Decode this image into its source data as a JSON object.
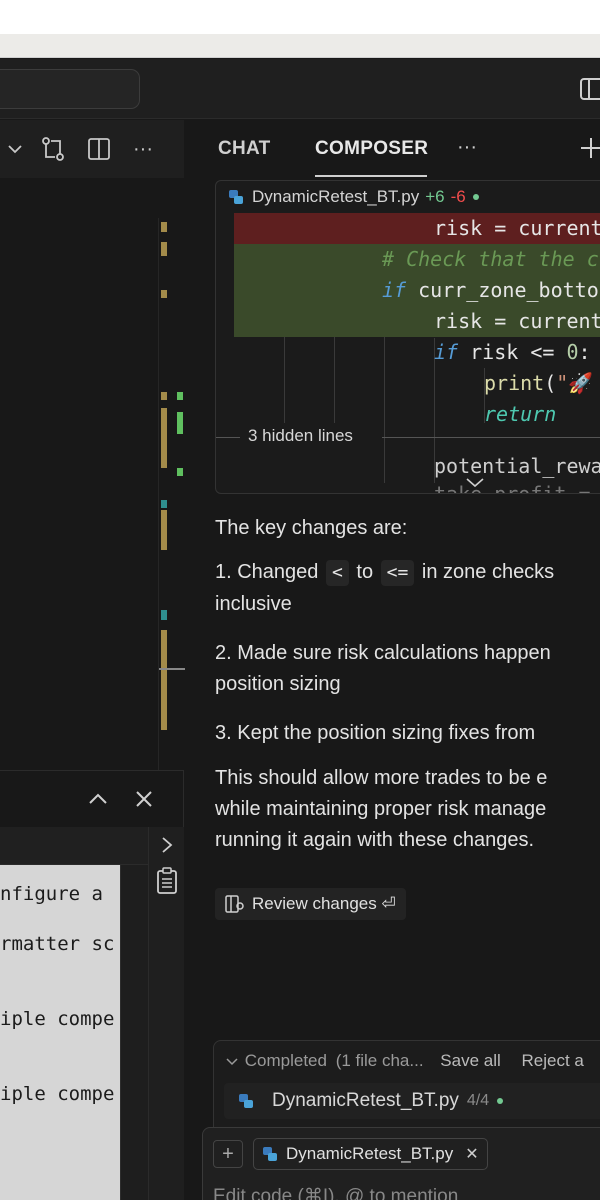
{
  "titlebar": {
    "search_icon": "search-box",
    "layout_icon": "toggle-layout-icon"
  },
  "editor_toolbar": {
    "icons": [
      "chevron-down-icon",
      "source-control-compare-icon",
      "split-editor-icon",
      "more-actions-icon"
    ]
  },
  "panel": {
    "icons": [
      "chevron-up-icon",
      "close-icon",
      "chevron-right-icon",
      "clipboard-icon"
    ],
    "terminal_lines": [
      "nfigure a",
      "rmatter sc",
      "iple compe",
      "iple compe"
    ]
  },
  "chat": {
    "tabs": [
      "CHAT",
      "COMPOSER"
    ],
    "active_tab": "COMPOSER",
    "diff": {
      "filename": "DynamicRetest_BT.py",
      "added": "+6",
      "removed": "-6",
      "lines": [
        "risk = current",
        "# Check that the c",
        "if curr_zone_botto",
        "risk = current",
        "if risk <= 0:",
        "print(\"🚀",
        "return",
        "potential_rewa",
        "take_profit ="
      ],
      "hidden_lines_label": "3 hidden lines"
    },
    "message": {
      "intro": "The key changes are:",
      "item1_prefix": "1. Changed",
      "item1_code_a": "<",
      "item1_mid": "to",
      "item1_code_b": "<=",
      "item1_suffix": "in zone checks",
      "item1_line2": "inclusive",
      "item2_line1": "2. Made sure risk calculations happen",
      "item2_line2": "position sizing",
      "item3": "3. Kept the position sizing fixes from",
      "closing_line1": "This should allow more trades to be e",
      "closing_line2": "while maintaining proper risk manage",
      "closing_line3": "running it again with these changes."
    },
    "review_button": "Review changes ⏎",
    "completed": {
      "status": "Completed",
      "detail": "(1 file cha...",
      "save_all": "Save all",
      "reject": "Reject a",
      "file": "DynamicRetest_BT.py",
      "progress": "4/4"
    },
    "input": {
      "context_file": "DynamicRetest_BT.py",
      "placeholder": "Edit code (⌘I), @ to mention"
    }
  },
  "colors": {
    "added_bg": "#3a4a2a",
    "removed_bg": "#5e1f1f",
    "green": "#73c991",
    "red": "#f14c4c",
    "keyword": "#569cd6",
    "function": "#dcdcaa",
    "number": "#b5cea8",
    "comment": "#6a9955"
  }
}
